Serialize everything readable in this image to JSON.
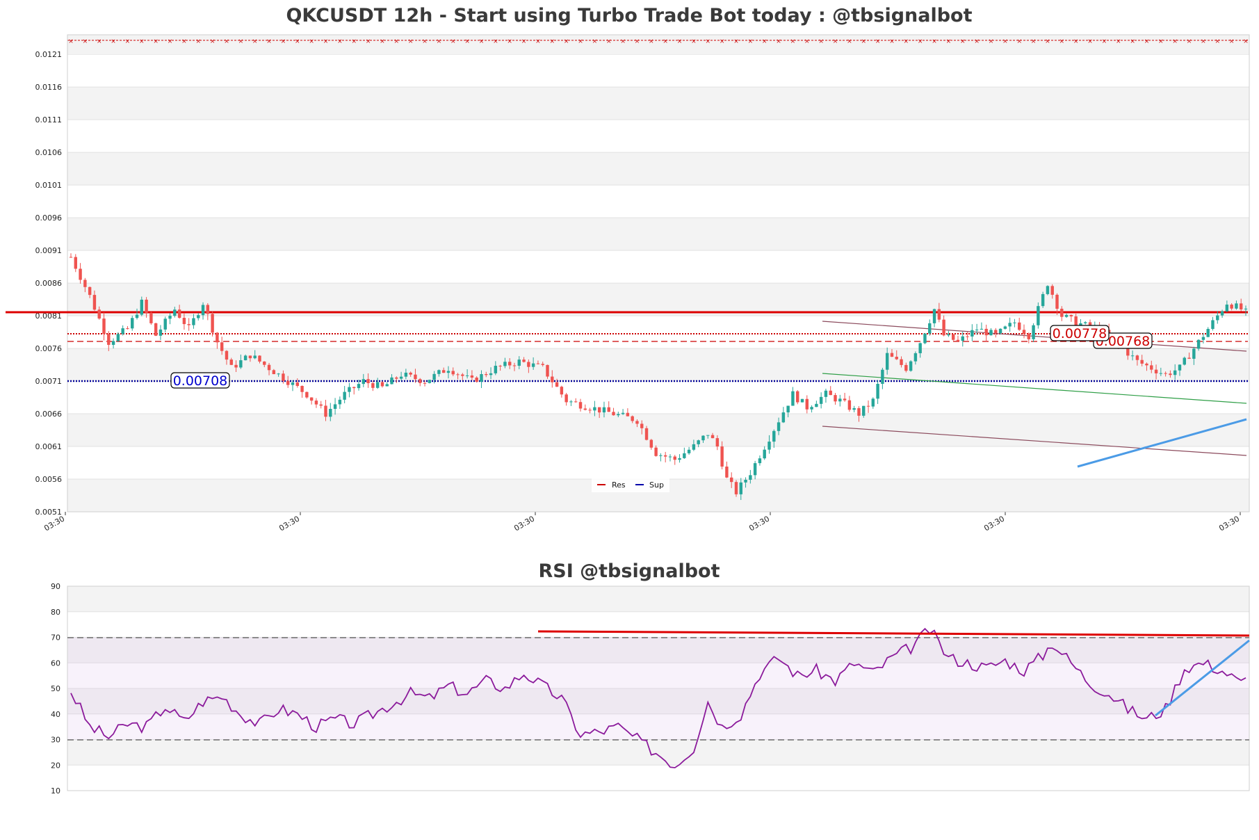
{
  "price_chart": {
    "title": "QKCUSDT 12h - Start using Turbo Trade Bot today : @tbsignalbot",
    "y_ticks": [
      "0.0051",
      "0.0056",
      "0.0061",
      "0.0066",
      "0.0071",
      "0.0076",
      "0.0081",
      "0.0086",
      "0.0091",
      "0.0096",
      "0.0101",
      "0.0106",
      "0.0111",
      "0.0116",
      "0.0121"
    ],
    "x_ticks": [
      "03:30",
      "03:30",
      "03:30",
      "03:30",
      "03:30",
      "03:30"
    ],
    "legend": [
      {
        "label": "Res",
        "color": "#cc0000"
      },
      {
        "label": "Sup",
        "color": "#0000aa"
      }
    ],
    "labels": {
      "support": "0.00708",
      "resistance_1": "0.00778",
      "resistance_2": "0.00768"
    }
  },
  "rsi_chart": {
    "title": "RSI @tbsignalbot",
    "y_ticks": [
      "10",
      "20",
      "30",
      "40",
      "50",
      "60",
      "70",
      "80",
      "90"
    ]
  },
  "chart_data": [
    {
      "type": "candlestick",
      "title": "QKCUSDT 12h - Start using Turbo Trade Bot today : @tbsignalbot",
      "ylim": [
        0.0051,
        0.0124
      ],
      "x_count": 250,
      "anchors": [
        [
          0,
          0.009
        ],
        [
          4,
          0.0084
        ],
        [
          8,
          0.0077
        ],
        [
          12,
          0.0079
        ],
        [
          15,
          0.0083
        ],
        [
          18,
          0.0078
        ],
        [
          22,
          0.0082
        ],
        [
          25,
          0.0079
        ],
        [
          28,
          0.0083
        ],
        [
          31,
          0.0077
        ],
        [
          34,
          0.0073
        ],
        [
          38,
          0.0075
        ],
        [
          42,
          0.0073
        ],
        [
          46,
          0.0071
        ],
        [
          50,
          0.0069
        ],
        [
          54,
          0.0066
        ],
        [
          58,
          0.0069
        ],
        [
          62,
          0.0071
        ],
        [
          66,
          0.007
        ],
        [
          70,
          0.0072
        ],
        [
          75,
          0.0071
        ],
        [
          80,
          0.0073
        ],
        [
          85,
          0.0071
        ],
        [
          90,
          0.0073
        ],
        [
          95,
          0.0074
        ],
        [
          100,
          0.0073
        ],
        [
          105,
          0.0068
        ],
        [
          110,
          0.0067
        ],
        [
          115,
          0.0066
        ],
        [
          120,
          0.0065
        ],
        [
          124,
          0.006
        ],
        [
          128,
          0.0059
        ],
        [
          132,
          0.0061
        ],
        [
          135,
          0.0063
        ],
        [
          137,
          0.0061
        ],
        [
          139,
          0.0056
        ],
        [
          141,
          0.0054
        ],
        [
          144,
          0.0057
        ],
        [
          147,
          0.0061
        ],
        [
          150,
          0.0065
        ],
        [
          153,
          0.0069
        ],
        [
          156,
          0.0067
        ],
        [
          160,
          0.0069
        ],
        [
          163,
          0.0068
        ],
        [
          167,
          0.0066
        ],
        [
          170,
          0.0068
        ],
        [
          173,
          0.0075
        ],
        [
          177,
          0.0073
        ],
        [
          180,
          0.0077
        ],
        [
          183,
          0.0082
        ],
        [
          185,
          0.0078
        ],
        [
          188,
          0.0077
        ],
        [
          192,
          0.0079
        ],
        [
          196,
          0.0078
        ],
        [
          200,
          0.008
        ],
        [
          203,
          0.0078
        ],
        [
          205,
          0.0082
        ],
        [
          207,
          0.0086
        ],
        [
          210,
          0.0081
        ],
        [
          213,
          0.008
        ],
        [
          217,
          0.0079
        ],
        [
          220,
          0.0078
        ],
        [
          223,
          0.0076
        ],
        [
          226,
          0.0074
        ],
        [
          229,
          0.0073
        ],
        [
          232,
          0.0072
        ],
        [
          235,
          0.0073
        ],
        [
          238,
          0.0076
        ],
        [
          242,
          0.008
        ],
        [
          245,
          0.0083
        ],
        [
          248,
          0.0082
        ],
        [
          250,
          0.0081
        ]
      ],
      "note_levels": {
        "support": 0.00708,
        "resistance": [
          0.00778,
          0.00768
        ],
        "main_resistance": 0.0081
      }
    },
    {
      "type": "line",
      "title": "RSI @tbsignalbot",
      "ylim": [
        10,
        90
      ],
      "reference_lines": [
        30,
        70
      ],
      "anchors": [
        [
          0,
          49
        ],
        [
          4,
          35
        ],
        [
          8,
          31
        ],
        [
          12,
          36
        ],
        [
          16,
          35
        ],
        [
          20,
          43
        ],
        [
          24,
          37
        ],
        [
          28,
          45
        ],
        [
          32,
          47
        ],
        [
          36,
          40
        ],
        [
          40,
          36
        ],
        [
          44,
          42
        ],
        [
          48,
          40
        ],
        [
          52,
          35
        ],
        [
          56,
          38
        ],
        [
          60,
          36
        ],
        [
          64,
          40
        ],
        [
          68,
          44
        ],
        [
          72,
          48
        ],
        [
          76,
          46
        ],
        [
          80,
          51
        ],
        [
          84,
          48
        ],
        [
          88,
          53
        ],
        [
          92,
          50
        ],
        [
          96,
          56
        ],
        [
          100,
          51
        ],
        [
          104,
          46
        ],
        [
          108,
          32
        ],
        [
          112,
          33
        ],
        [
          116,
          35
        ],
        [
          120,
          30
        ],
        [
          124,
          25
        ],
        [
          128,
          20
        ],
        [
          132,
          27
        ],
        [
          135,
          45
        ],
        [
          138,
          35
        ],
        [
          142,
          40
        ],
        [
          146,
          56
        ],
        [
          150,
          62
        ],
        [
          154,
          55
        ],
        [
          158,
          57
        ],
        [
          162,
          53
        ],
        [
          166,
          60
        ],
        [
          170,
          56
        ],
        [
          174,
          62
        ],
        [
          178,
          66
        ],
        [
          182,
          73
        ],
        [
          186,
          62
        ],
        [
          190,
          60
        ],
        [
          194,
          58
        ],
        [
          198,
          61
        ],
        [
          202,
          57
        ],
        [
          206,
          63
        ],
        [
          208,
          68
        ],
        [
          212,
          60
        ],
        [
          216,
          52
        ],
        [
          220,
          48
        ],
        [
          224,
          42
        ],
        [
          228,
          38
        ],
        [
          232,
          42
        ],
        [
          236,
          58
        ],
        [
          240,
          60
        ],
        [
          244,
          57
        ],
        [
          248,
          52
        ],
        [
          250,
          55
        ]
      ]
    }
  ]
}
